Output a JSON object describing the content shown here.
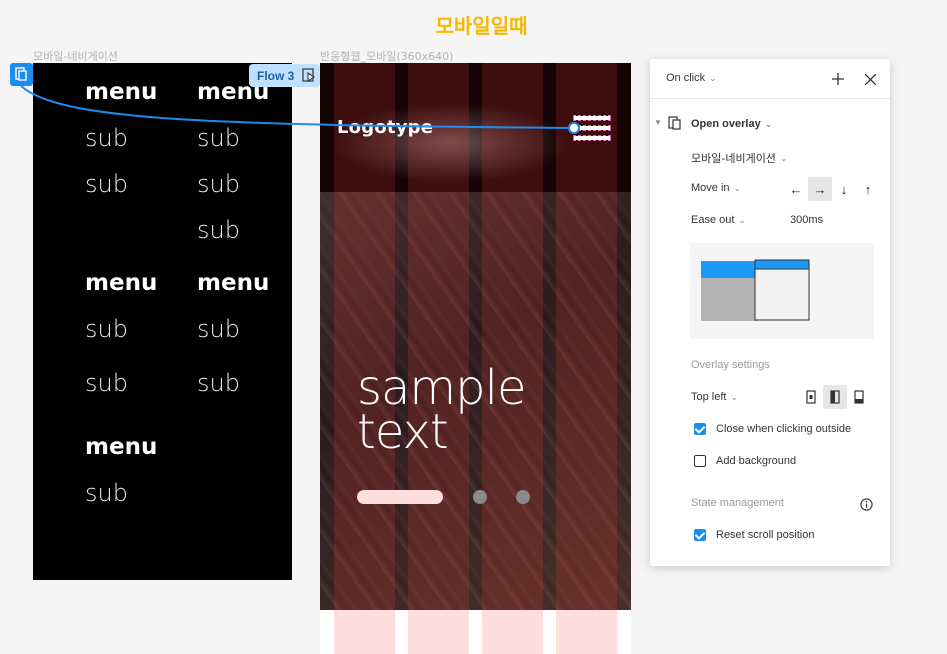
{
  "page": {
    "title": "모바일일때"
  },
  "frames": {
    "left_label": "모바일-네비게이션",
    "middle_label": "반응형웹_모바일(360x640)"
  },
  "flow": {
    "label": "Flow 3"
  },
  "nav": {
    "menu_label": "menu",
    "sub_label": "sub"
  },
  "web": {
    "logo": "Logotype",
    "hero_line1": "sample",
    "hero_line2": "text"
  },
  "panel": {
    "trigger": "On click",
    "action": "Open overlay",
    "destination": "모바일-네비게이션",
    "animation": "Move in",
    "directions": [
      "←",
      "→",
      "↓",
      "↑"
    ],
    "active_direction": "→",
    "easing": "Ease out",
    "duration": "300ms",
    "overlay_settings_title": "Overlay settings",
    "position": "Top left",
    "close_outside_label": "Close when clicking outside",
    "close_outside_checked": true,
    "add_background_label": "Add background",
    "add_background_checked": false,
    "state_management_title": "State management",
    "reset_scroll_label": "Reset scroll position",
    "reset_scroll_checked": true
  },
  "colors": {
    "accent": "#1b8cf0",
    "title": "#f5b800",
    "flow_badge": "#bfe1ff",
    "nav_bg": "#000000",
    "web_header": "#140404",
    "grid_overlay": "#ff3c3c",
    "pink_block": "#ffdede"
  },
  "icons": {
    "start_marker": "overlay-frame-icon",
    "flow_play": "play-icon",
    "add": "plus-icon",
    "close": "close-icon",
    "info": "info-icon",
    "hamburger": "hamburger-icon"
  }
}
